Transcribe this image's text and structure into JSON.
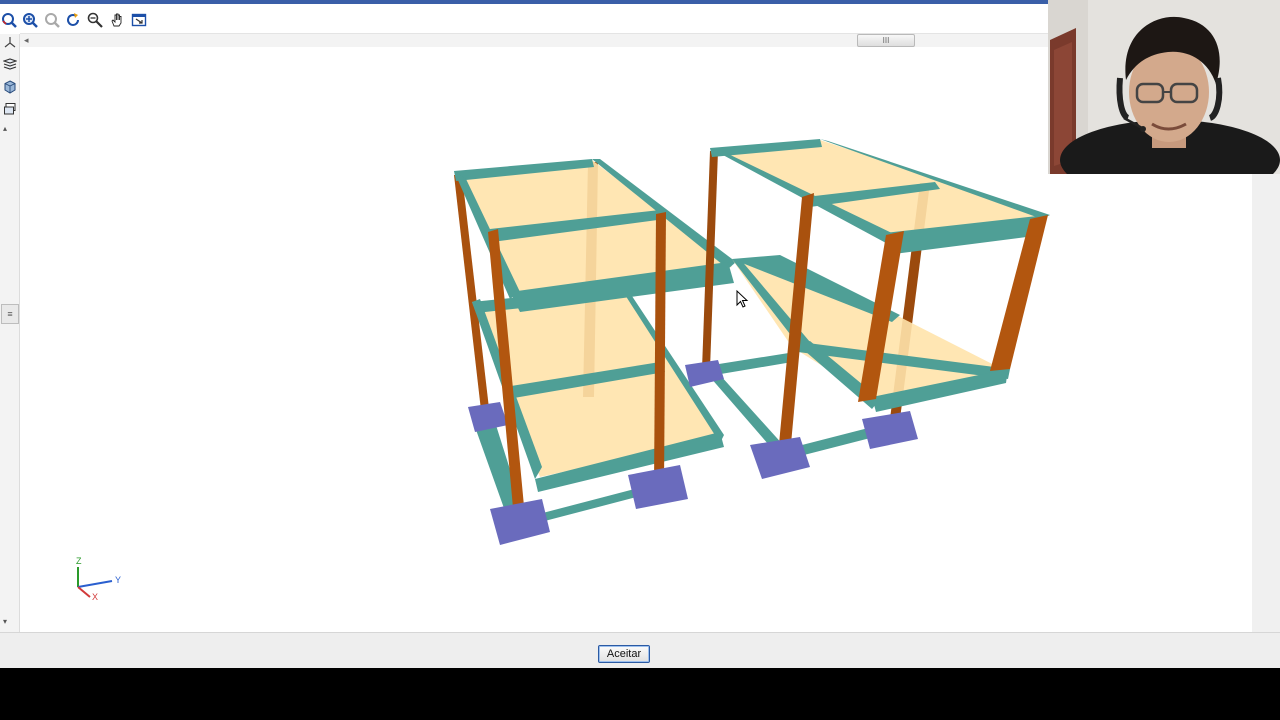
{
  "toolbar": {
    "buttons": [
      {
        "name": "zoom-window-icon"
      },
      {
        "name": "zoom-extents-icon"
      },
      {
        "name": "zoom-previous-icon"
      },
      {
        "name": "rotate-icon"
      },
      {
        "name": "zoom-in-out-icon"
      },
      {
        "name": "pan-hand-icon"
      },
      {
        "name": "view-window-icon"
      }
    ],
    "scrollbar_thumb_label": "III"
  },
  "left_tools": {
    "buttons": [
      {
        "name": "axes-icon"
      },
      {
        "name": "layers-icon"
      },
      {
        "name": "solid-view-icon"
      },
      {
        "name": "3d-view-icon"
      }
    ],
    "grip_label": "≡"
  },
  "viewport": {
    "axis_triad": {
      "z_label": "Z",
      "y_label": "Y",
      "x_label": "X"
    },
    "colors": {
      "beam": "#4f9f96",
      "column": "#b2560f",
      "slab": "#ffe3ab",
      "footing": "#6a6bbd"
    }
  },
  "footer": {
    "accept_label": "Aceitar"
  },
  "webcam": {
    "description_icon": "presenter-webcam-icon"
  }
}
